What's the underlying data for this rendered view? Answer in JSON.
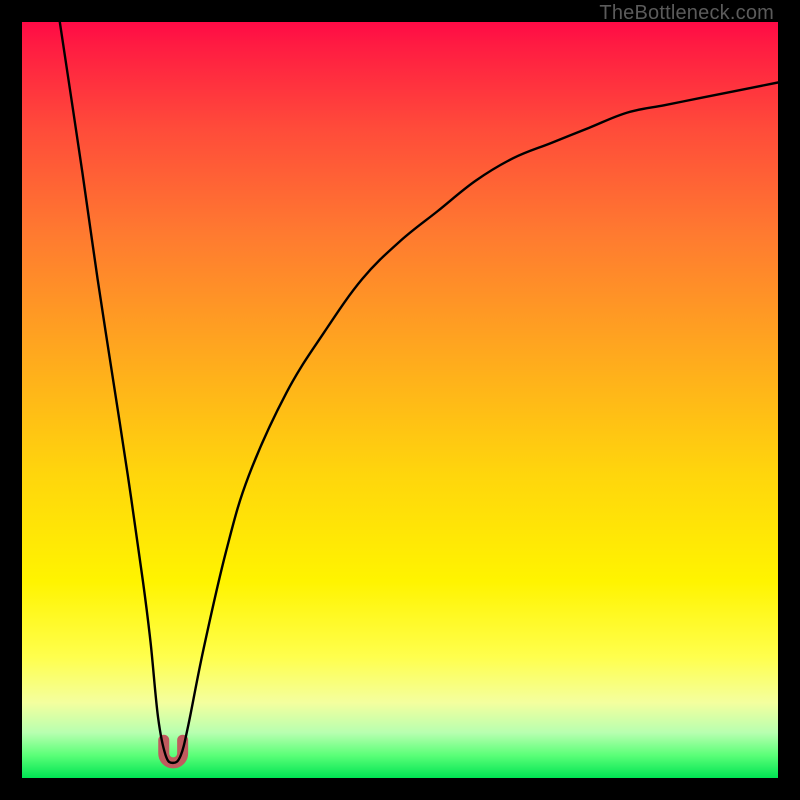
{
  "watermark": "TheBottleneck.com",
  "chart_data": {
    "type": "line",
    "title": "",
    "xlabel": "",
    "ylabel": "",
    "xlim": [
      0,
      100
    ],
    "ylim": [
      0,
      100
    ],
    "grid": false,
    "legend": false,
    "series": [
      {
        "name": "bottleneck-curve",
        "x": [
          5,
          8,
          10,
          12,
          14,
          16,
          17,
          18,
          19,
          20,
          21,
          22,
          24,
          27,
          30,
          35,
          40,
          45,
          50,
          55,
          60,
          65,
          70,
          75,
          80,
          85,
          90,
          95,
          100
        ],
        "values": [
          100,
          80,
          66,
          53,
          40,
          26,
          18,
          8,
          3,
          2,
          3,
          7,
          17,
          30,
          40,
          51,
          59,
          66,
          71,
          75,
          79,
          82,
          84,
          86,
          88,
          89,
          90,
          91,
          92
        ]
      }
    ],
    "marker": {
      "name": "highlight-u",
      "x_center": 20,
      "x_width": 2.5,
      "y_bottom": 2,
      "y_top": 5,
      "color": "#c05a5e"
    },
    "gradient_stops": [
      {
        "pos": 0,
        "color": "#ff0a46"
      },
      {
        "pos": 14,
        "color": "#ff4b3a"
      },
      {
        "pos": 43,
        "color": "#ffa61f"
      },
      {
        "pos": 74,
        "color": "#fff400"
      },
      {
        "pos": 94,
        "color": "#b8ffb0"
      },
      {
        "pos": 100,
        "color": "#00e453"
      }
    ]
  }
}
